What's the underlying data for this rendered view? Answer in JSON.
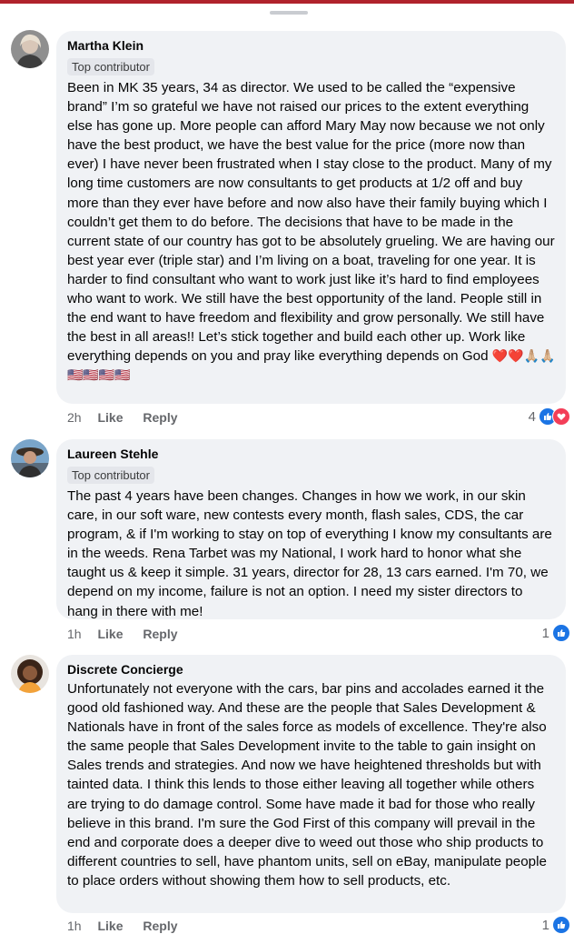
{
  "comments": [
    {
      "author": "Martha Klein",
      "badge": "Top contributor",
      "text": "Been in MK 35 years, 34 as director. We used to be called the “expensive brand” I’m so grateful we have not raised our prices to the extent everything else has gone up. More people can afford Mary May now because we not only have  the best product, we have the best value for the price (more now than ever) I have never been frustrated when I stay close to the product.  Many of my long time customers are now consultants to get products at 1/2 off and buy more than they ever have before and now also have their family buying which I couldn’t get them to do before.  The decisions that have to be made in the current state of our country has got to be absolutely grueling. We are having our best year ever (triple star) and I’m living on a boat, traveling for one year.  It is harder to find consultant who want to work just like it’s hard to find employees who want to work.  We still have the best opportunity of the land.  People still in the end want to have freedom and flexibility and grow personally. We still have the best in all areas!! Let’s stick together and build each other up.  Work like everything depends on you and pray like everything depends on God",
      "emojis": "❤️❤️🙏🏼🙏🏼🇺🇸🇺🇸🇺🇸🇺🇸",
      "time": "2h",
      "like": "Like",
      "reply": "Reply",
      "reaction_count": "4"
    },
    {
      "author": "Laureen Stehle",
      "badge": "Top contributor",
      "text": "The past 4 years have been changes. Changes in how we work, in our skin care, in our soft ware, new contests every month, flash sales, CDS, the car program, & if I'm working to stay on top of everything I know my consultants are in the weeds. Rena Tarbet was my National, I work hard to honor what she taught us & keep it simple. 31 years, director for 28, 13 cars earned. I'm 70, we depend on my income, failure is not an option. I need my sister directors to hang in there with me!",
      "time": "1h",
      "like": "Like",
      "reply": "Reply",
      "reaction_count": "1"
    },
    {
      "author": "Discrete Concierge",
      "text": "Unfortunately not everyone with the cars, bar pins and accolades earned it the good old fashioned way. And these are the people that Sales Development & Nationals have in front of the sales force as models of excellence.  They're also the same people that Sales Development invite to the table to gain insight on Sales trends and strategies.  And now we have heightened thresholds but with tainted data. I think this lends to those either leaving all together while others are trying to do damage control.  Some have made it bad for those who really believe in this brand. I'm sure the God First of this company will prevail in the end and corporate does a deeper dive to weed out those who ship products to different countries to sell, have phantom units, sell on eBay, manipulate people to place orders without showing them how to sell products, etc.",
      "time": "1h",
      "like": "Like",
      "reply": "Reply",
      "reaction_count": "1"
    }
  ],
  "colors": {
    "bubble": "#f0f2f5",
    "badge": "#e4e6eb",
    "meta": "#65676b",
    "like_blue": "#1b74e4",
    "love_red": "#f33e58",
    "top_strip": "#b0222c"
  }
}
